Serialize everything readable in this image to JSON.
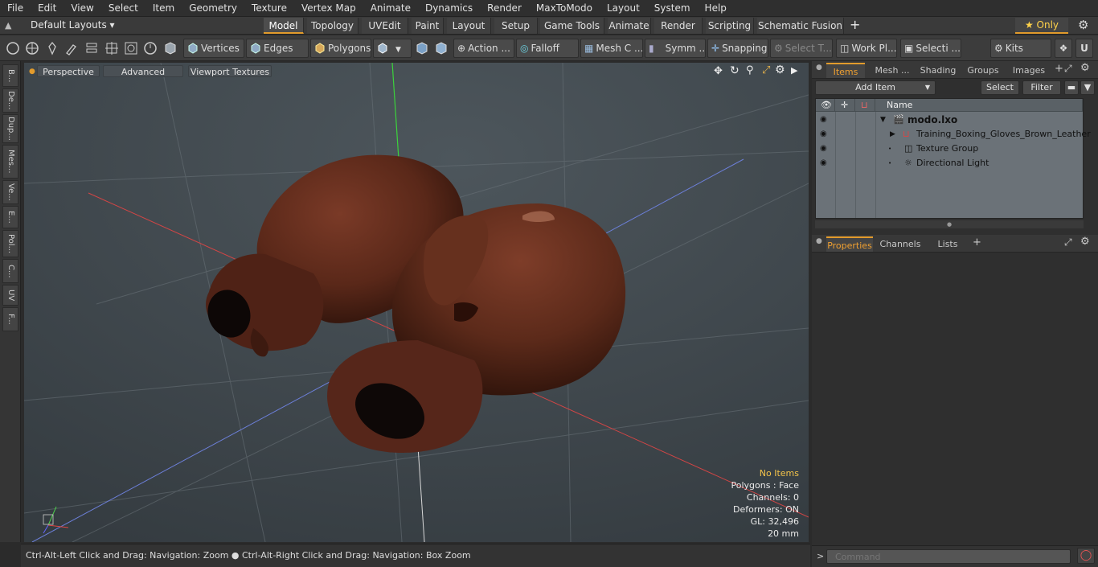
{
  "menu": [
    "File",
    "Edit",
    "View",
    "Select",
    "Item",
    "Geometry",
    "Texture",
    "Vertex Map",
    "Animate",
    "Dynamics",
    "Render",
    "MaxToModo",
    "Layout",
    "System",
    "Help"
  ],
  "layout_selector": "Default Layouts ▾",
  "layout_tabs": [
    {
      "label": "Model",
      "active": true
    },
    {
      "label": "Topology"
    },
    {
      "label": "UVEdit"
    },
    {
      "label": "Paint"
    },
    {
      "label": "Layout"
    },
    {
      "label": "Setup"
    },
    {
      "label": "Game Tools"
    },
    {
      "label": "Animate"
    },
    {
      "label": "Render"
    },
    {
      "label": "Scripting"
    },
    {
      "label": "Schematic Fusion"
    }
  ],
  "layout_add": "+",
  "only_label": "★ Only",
  "toolbar": {
    "vertices": "Vertices",
    "edges": "Edges",
    "polygons": "Polygons",
    "action": "Action ...",
    "falloff": "Falloff",
    "mesh": "Mesh C ...",
    "symm": "Symm ...",
    "snapping": "Snapping",
    "select_t": "Select T...",
    "work_pl": "Work Pl...",
    "selecti": "Selecti ...",
    "kits": "Kits"
  },
  "left_tabs": [
    "B...",
    "De...",
    "Dup...",
    "Mes...",
    "Ve...",
    "E...",
    "Pol...",
    "C...",
    "UV",
    "F..."
  ],
  "viewport": {
    "perspective": "Perspective",
    "advanced": "Advanced",
    "textures": "Viewport Textures",
    "stats": {
      "no_items": "No Items",
      "polygons": "Polygons : Face",
      "channels": "Channels: 0",
      "deformers": "Deformers: ON",
      "gl": "GL: 32,496",
      "size": "20 mm"
    }
  },
  "status_text": "Ctrl-Alt-Left Click and Drag: Navigation: Zoom ● Ctrl-Alt-Right Click and Drag: Navigation: Box Zoom",
  "items_panel": {
    "tabs": [
      "Items",
      "Mesh ...",
      "Shading",
      "Groups",
      "Images"
    ],
    "add_item": "Add Item",
    "select": "Select",
    "filter": "Filter",
    "name_header": "Name",
    "rows": [
      "modo.lxo",
      "Training_Boxing_Gloves_Brown_Leather",
      "Texture Group",
      "Directional Light"
    ]
  },
  "properties_panel": {
    "tabs": [
      "Properties",
      "Channels",
      "Lists"
    ]
  },
  "command_placeholder": "Command",
  "colors": {
    "accent": "#e29b2c",
    "glove": "#5e2a1c",
    "viewport": "#434c52"
  }
}
